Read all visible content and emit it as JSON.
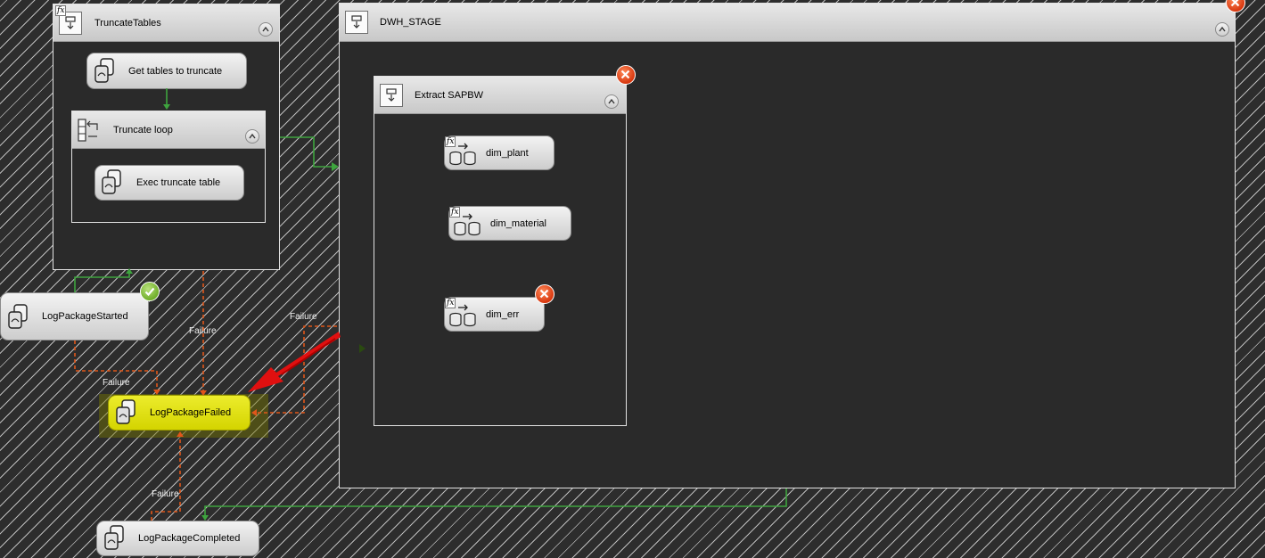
{
  "containers": {
    "truncate_tables": {
      "title": "TruncateTables"
    },
    "truncate_loop": {
      "title": "Truncate loop"
    },
    "dwh_stage": {
      "title": "DWH_STAGE"
    },
    "extract_sapbw": {
      "title": "Extract SAPBW"
    }
  },
  "tasks": {
    "get_tables": "Get tables to truncate",
    "exec_truncate": "Exec truncate table",
    "log_started": "LogPackageStarted",
    "log_failed": "LogPackageFailed",
    "log_completed": "LogPackageCompleted",
    "dim_plant": "dim_plant",
    "dim_material": "dim_material",
    "dim_err": "dim_err"
  },
  "constraints": {
    "failure_label": "Failure"
  },
  "fx_marker": "fx",
  "colors": {
    "success_line": "#3ea43e",
    "failure_line": "#e0561a",
    "highlight": "#dcdc00",
    "error_badge": "#d8380f",
    "success_badge": "#6fae2a",
    "arrow_annotation": "#e01010"
  },
  "icons": {
    "execute_sql": "execute-sql-task-icon",
    "data_flow": "data-flow-task-icon",
    "sequence": "sequence-container-icon",
    "foreach": "foreach-loop-icon",
    "error": "error-icon",
    "success": "success-check-icon",
    "collapse": "chevron-up-icon"
  }
}
